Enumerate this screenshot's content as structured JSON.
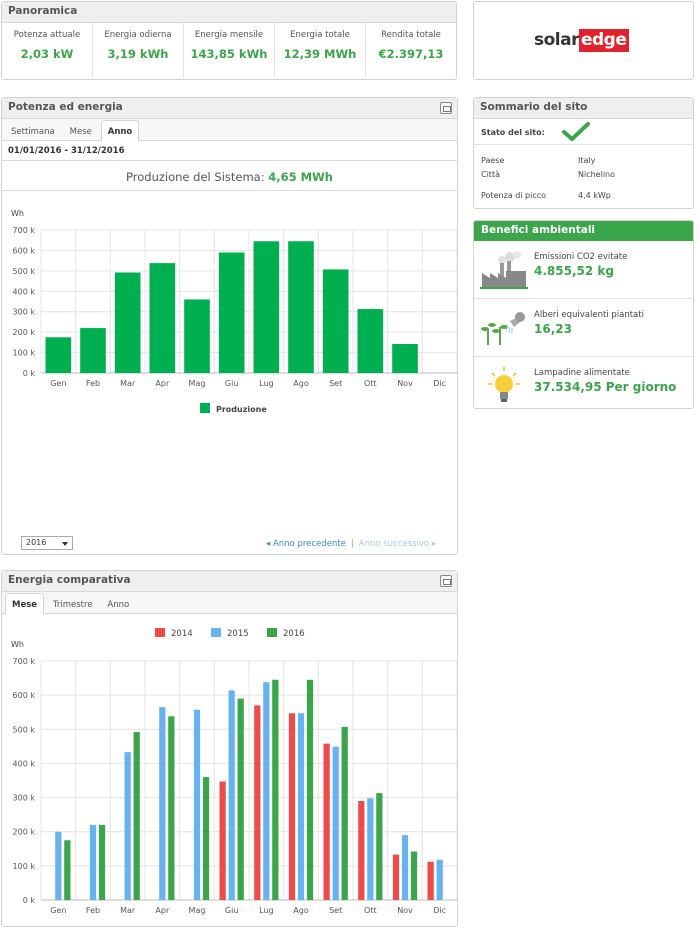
{
  "overview": {
    "title": "Panoramica",
    "cells": [
      {
        "label": "Potenza attuale",
        "value": "2,03 kW"
      },
      {
        "label": "Energia odierna",
        "value": "3,19 kWh"
      },
      {
        "label": "Energia mensile",
        "value": "143,85 kWh"
      },
      {
        "label": "Energia totale",
        "value": "12,39 MWh"
      },
      {
        "label": "Rendita totale",
        "value": "€2.397,13"
      }
    ]
  },
  "brand": {
    "logo_part1": "solar",
    "logo_part2": "edge",
    "accent": "#e1212b"
  },
  "power_energy": {
    "title": "Potenza ed energia",
    "tabs": [
      "Settimana",
      "Mese",
      "Anno"
    ],
    "active_tab": "Anno",
    "date_range": "01/01/2016 - 31/12/2016",
    "production_label": "Produzione del Sistema:",
    "production_value": "4,65 MWh",
    "year_select": "2016",
    "prev_label": "Anno precedente",
    "separator": "|",
    "next_label": "Anno successivo"
  },
  "comparative": {
    "title": "Energia comparativa",
    "tabs": [
      "Mese",
      "Trimestre",
      "Anno"
    ],
    "active_tab": "Mese"
  },
  "site_summary": {
    "title": "Sommario del sito",
    "status_label": "Stato del sito:",
    "rows": [
      {
        "label": "Paese",
        "value": "Italy"
      },
      {
        "label": "Città",
        "value": "Nichelino"
      },
      {
        "label": "Potenza di picco",
        "value": "4,4 kWp"
      }
    ]
  },
  "environment": {
    "title": "Benefici ambientali",
    "items": [
      {
        "label": "Emissioni CO2 evitate",
        "value": "4.855,52 kg",
        "icon": "factory-icon"
      },
      {
        "label": "Alberi equivalenti piantati",
        "value": "16,23",
        "icon": "tree-watering-icon"
      },
      {
        "label": "Lampadine alimentate",
        "value": "37.534,95 Per giorno",
        "icon": "lightbulb-icon"
      }
    ]
  },
  "colors": {
    "green": "#3aa54a",
    "bar_green": "#00b050",
    "red": "#ee4b4b",
    "blue": "#66b3ef",
    "header_green": "#3aa54a"
  },
  "chart_data": [
    {
      "type": "bar",
      "ylabel": "Wh",
      "categories": [
        "Gen",
        "Feb",
        "Mar",
        "Apr",
        "Mag",
        "Giu",
        "Lug",
        "Ago",
        "Set",
        "Ott",
        "Nov",
        "Dic"
      ],
      "yticks": [
        "0 k",
        "100 k",
        "200 k",
        "300 k",
        "400 k",
        "500 k",
        "600 k",
        "700 k"
      ],
      "ylim": [
        0,
        700000
      ],
      "series": [
        {
          "name": "Produzione",
          "color": "#00b050",
          "values": [
            175000,
            220000,
            492000,
            538000,
            360000,
            590000,
            645000,
            645000,
            507000,
            313000,
            142000,
            null
          ]
        }
      ],
      "grid": true,
      "legend": "bottom-center"
    },
    {
      "type": "bar",
      "ylabel": "Wh",
      "categories": [
        "Gen",
        "Feb",
        "Mar",
        "Apr",
        "Mag",
        "Giu",
        "Lug",
        "Ago",
        "Set",
        "Ott",
        "Nov",
        "Dic"
      ],
      "yticks": [
        "0 k",
        "100 k",
        "200 k",
        "300 k",
        "400 k",
        "500 k",
        "600 k",
        "700 k"
      ],
      "ylim": [
        0,
        700000
      ],
      "series": [
        {
          "name": "2014",
          "color": "#ee4b4b",
          "values": [
            null,
            null,
            null,
            null,
            null,
            347000,
            570000,
            547000,
            458000,
            290000,
            133000,
            112000
          ]
        },
        {
          "name": "2015",
          "color": "#66b3ef",
          "values": [
            200000,
            220000,
            433000,
            565000,
            557000,
            614000,
            638000,
            547000,
            449000,
            298000,
            190000,
            118000
          ]
        },
        {
          "name": "2016",
          "color": "#3aa54a",
          "values": [
            175000,
            220000,
            492000,
            538000,
            360000,
            590000,
            645000,
            645000,
            507000,
            313000,
            142000,
            null
          ]
        }
      ],
      "grid": true,
      "legend": "top-center"
    }
  ]
}
